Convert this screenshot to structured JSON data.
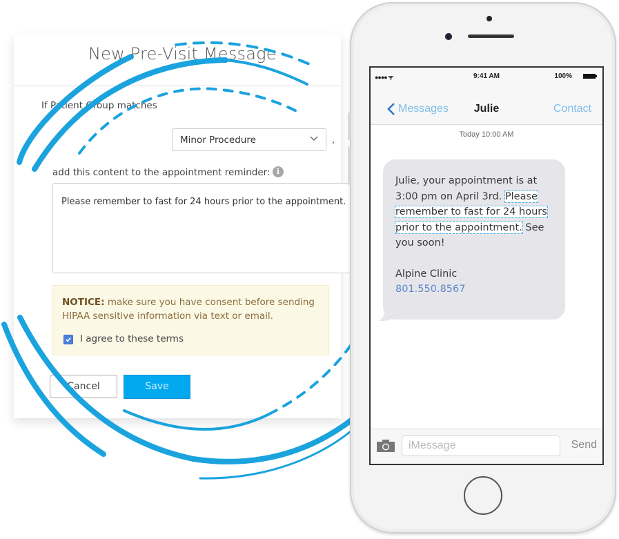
{
  "dialog": {
    "title": "New Pre-Visit Message",
    "rule_label": "If Patient Group matches",
    "patient_group_select": {
      "value": "Minor Procedure"
    },
    "trailing_comma": ",",
    "content_label": "add this content to the appointment reminder:",
    "content_textarea": {
      "value": "Please remember to fast for 24 hours prior to the appointment."
    },
    "notice": {
      "prefix": "NOTICE:",
      "text": " make sure you have consent before sending HIPAA sensitive information via text or email."
    },
    "agree_checkbox": {
      "label": "I agree to these terms",
      "checked": true
    },
    "cancel_label": "Cancel",
    "save_label": "Save"
  },
  "phone": {
    "status_bar": {
      "signal": "●●●● ᯤ",
      "time": "9:41 AM",
      "battery": "100%"
    },
    "nav": {
      "back_label": "Messages",
      "title": "Julie",
      "contact_label": "Contact"
    },
    "timestamp": {
      "day": "Today",
      "time": "10:00 AM"
    },
    "message": {
      "intro": "Julie, your appointment is at 3:00 pm on April 3rd.",
      "highlight_1": "Please",
      "highlight_2": "remember to fast for 24 hours",
      "highlight_3": "prior to the appointment.",
      "outro": "See you soon!",
      "signature": "Alpine Clinic",
      "phone_number": "801.550.8567"
    },
    "input_bar": {
      "placeholder": "iMessage",
      "send_label": "Send"
    }
  },
  "colors": {
    "accent": "#03a9ef",
    "arc": "#1ba3de",
    "notice_bg": "#fcf8e6",
    "link": "#5b87c9"
  }
}
